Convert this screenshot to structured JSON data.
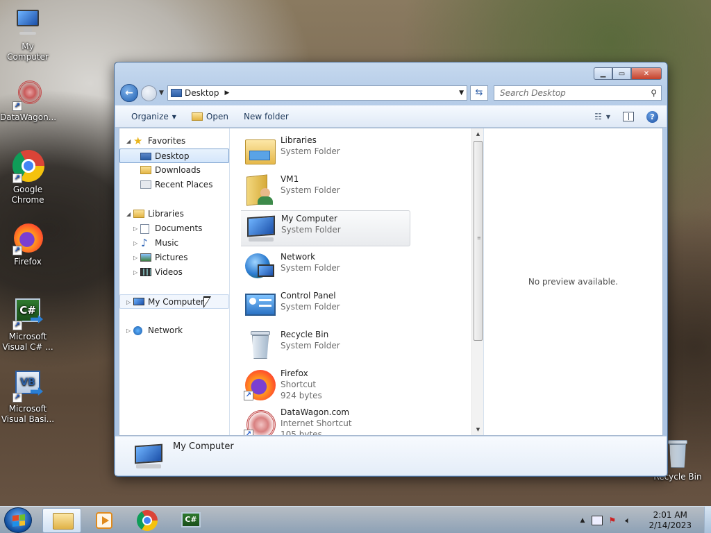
{
  "desktop": {
    "icons": [
      {
        "label": "My Computer"
      },
      {
        "label": "DataWagon..."
      },
      {
        "label": "Google Chrome"
      },
      {
        "label": "Firefox"
      },
      {
        "label": "Microsoft Visual C# ..."
      },
      {
        "label": "Microsoft Visual Basi..."
      },
      {
        "label": "Recycle Bin"
      }
    ]
  },
  "window": {
    "address": {
      "location": "Desktop"
    },
    "search": {
      "placeholder": "Search Desktop"
    },
    "toolbar": {
      "organize": "Organize",
      "open": "Open",
      "new_folder": "New folder"
    },
    "nav_pane": {
      "favorites": "Favorites",
      "desktop": "Desktop",
      "downloads": "Downloads",
      "recent_places": "Recent Places",
      "libraries": "Libraries",
      "documents": "Documents",
      "music": "Music",
      "pictures": "Pictures",
      "videos": "Videos",
      "my_computer": "My Computer",
      "network": "Network"
    },
    "files": [
      {
        "name": "Libraries",
        "type": "System Folder",
        "size": ""
      },
      {
        "name": "VM1",
        "type": "System Folder",
        "size": ""
      },
      {
        "name": "My Computer",
        "type": "System Folder",
        "size": ""
      },
      {
        "name": "Network",
        "type": "System Folder",
        "size": ""
      },
      {
        "name": "Control Panel",
        "type": "System Folder",
        "size": ""
      },
      {
        "name": "Recycle Bin",
        "type": "System Folder",
        "size": ""
      },
      {
        "name": "Firefox",
        "type": "Shortcut",
        "size": "924 bytes"
      },
      {
        "name": "DataWagon.com",
        "type": "Internet Shortcut",
        "size": "105 bytes"
      }
    ],
    "preview": {
      "text": "No preview available."
    },
    "details": {
      "name": "My Computer"
    }
  },
  "taskbar": {
    "clock": {
      "time": "2:01 AM",
      "date": "2/14/2023"
    }
  },
  "colors": {
    "accent": "#1f5fb0",
    "selection": "#d4e6fb",
    "window_frame": "#b7cde8"
  }
}
